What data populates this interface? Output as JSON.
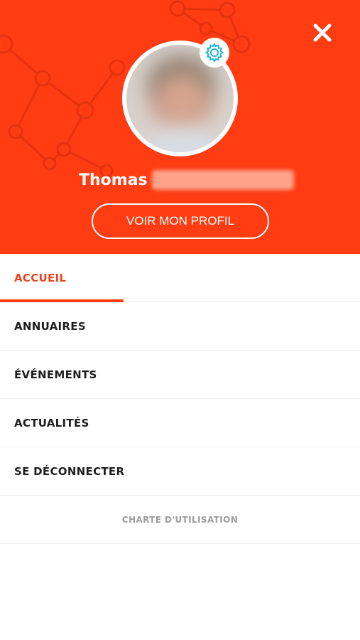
{
  "header": {
    "background_color": "#ff3c12",
    "close_icon": "close-icon",
    "settings_icon": "gear-icon",
    "user": {
      "first_name": "Thomas"
    },
    "profile_button_label": "VOIR MON PROFIL"
  },
  "menu": {
    "items": [
      {
        "label": "ACCUEIL",
        "active": true
      },
      {
        "label": "ANNUAIRES",
        "active": false
      },
      {
        "label": "ÉVÉNEMENTS",
        "active": false
      },
      {
        "label": "ACTUALITÉS",
        "active": false
      },
      {
        "label": "SE DÉCONNECTER",
        "active": false
      }
    ],
    "footer_link": "CHARTE D'UTILISATION"
  },
  "colors": {
    "accent": "#ff3c12",
    "active_text": "#e8451e",
    "settings_icon": "#1fb6d4",
    "menu_text": "#1e1e1e",
    "footer_text": "#9c9c9c"
  }
}
